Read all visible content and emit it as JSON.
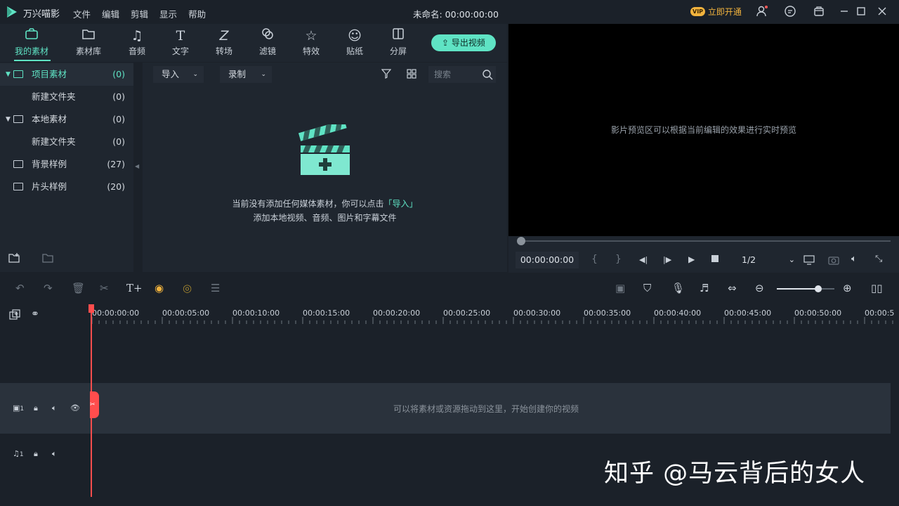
{
  "app": {
    "name": "万兴喵影",
    "project_title": "未命名: 00:00:00:00",
    "vip_label": "立即开通",
    "vip_badge": "VIP"
  },
  "menu": [
    "文件",
    "编辑",
    "剪辑",
    "显示",
    "帮助"
  ],
  "toolbar": {
    "tabs": [
      {
        "label": "我的素材",
        "icon": "my-media-icon"
      },
      {
        "label": "素材库",
        "icon": "library-icon"
      },
      {
        "label": "音频",
        "icon": "music-note-icon"
      },
      {
        "label": "文字",
        "icon": "text-icon"
      },
      {
        "label": "转场",
        "icon": "transition-icon"
      },
      {
        "label": "滤镜",
        "icon": "filter-icon"
      },
      {
        "label": "特效",
        "icon": "effects-icon"
      },
      {
        "label": "贴纸",
        "icon": "sticker-icon"
      },
      {
        "label": "分屏",
        "icon": "split-screen-icon"
      }
    ],
    "export_label": "导出视频"
  },
  "media_tree": [
    {
      "label": "项目素材",
      "count": "(0)",
      "active": true,
      "expanded": true
    },
    {
      "label": "新建文件夹",
      "count": "(0)"
    },
    {
      "label": "本地素材",
      "count": "(0)",
      "expanded": true
    },
    {
      "label": "新建文件夹",
      "count": "(0)"
    },
    {
      "label": "背景样例",
      "count": "(27)"
    },
    {
      "label": "片头样例",
      "count": "(20)"
    }
  ],
  "media_toolbar": {
    "import_label": "导入",
    "record_label": "录制",
    "search_placeholder": "搜索"
  },
  "empty_state": {
    "line1_prefix": "当前没有添加任何媒体素材，你可以点击",
    "line1_link": "「导入」",
    "line2": "添加本地视频、音频、图片和字幕文件"
  },
  "preview": {
    "hint": "影片预览区可以根据当前编辑的效果进行实时预览",
    "timecode": "00:00:00:00",
    "quality": "1/2"
  },
  "timeline": {
    "ticks": [
      "00:00:00:00",
      "00:00:05:00",
      "00:00:10:00",
      "00:00:15:00",
      "00:00:20:00",
      "00:00:25:00",
      "00:00:30:00",
      "00:00:35:00",
      "00:00:40:00",
      "00:00:45:00",
      "00:00:50:00",
      "00:00:5"
    ],
    "video_track_label": "1",
    "audio_track_label": "1",
    "drop_hint": "可以将素材或资源拖动到这里，开始创建你的视频",
    "zoom_level": 0.72
  },
  "watermark": "知乎 @马云背后的女人",
  "colors": {
    "accent": "#5fe3c4",
    "playhead": "#ff4d4d",
    "bg": "#1b2129",
    "panel": "#1f262f"
  }
}
